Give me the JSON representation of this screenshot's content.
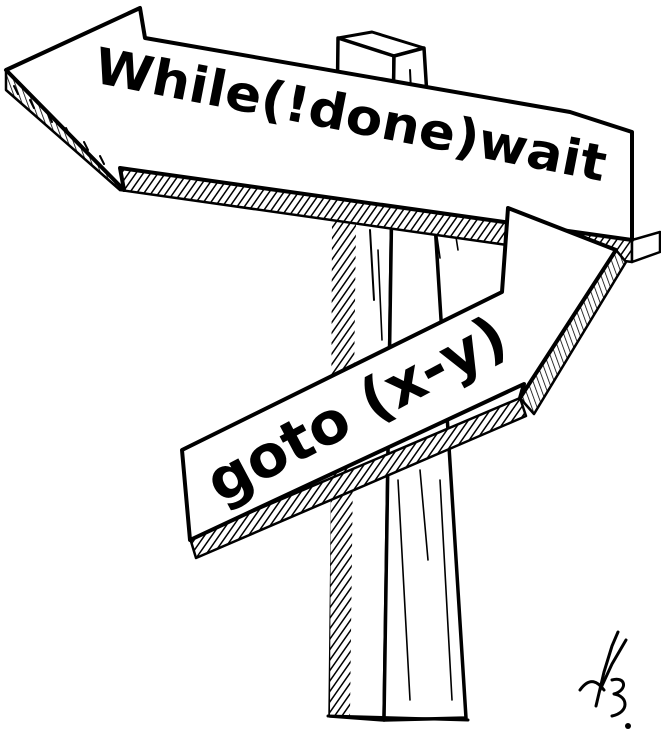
{
  "signs": {
    "top_text": "While(!done)wait",
    "bottom_text": "goto (x-y)"
  },
  "signature": "FB",
  "colors": {
    "ink": "#000000",
    "paper": "#ffffff"
  }
}
